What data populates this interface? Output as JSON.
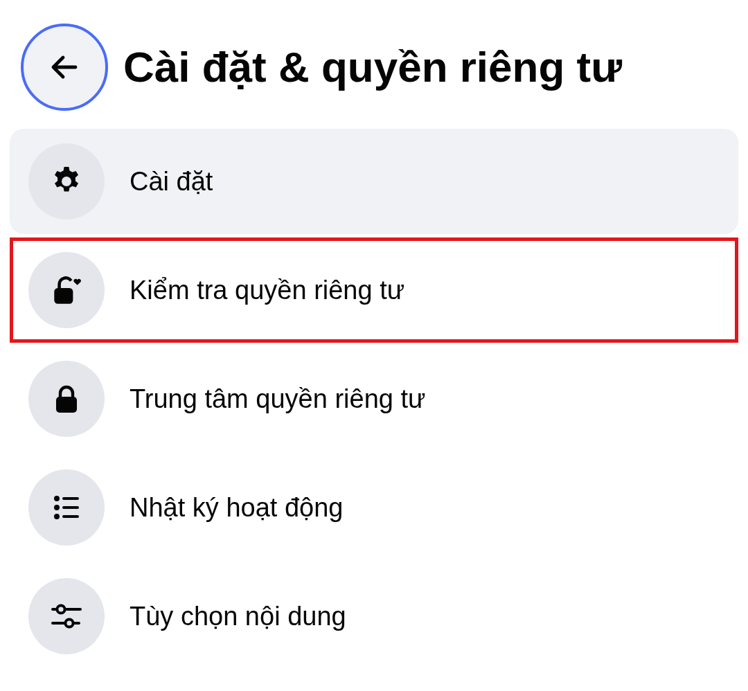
{
  "header": {
    "back_button": {
      "focused": true
    },
    "title": "Cài đặt & quyền riêng tư"
  },
  "items": [
    {
      "kind": "gear",
      "label": "Cài đặt",
      "hovered": true,
      "outlined": false
    },
    {
      "kind": "lock-heart",
      "label": "Kiểm tra quyền riêng tư",
      "hovered": false,
      "outlined": true
    },
    {
      "kind": "lock",
      "label": "Trung tâm quyền riêng tư",
      "hovered": false,
      "outlined": false
    },
    {
      "kind": "list",
      "label": "Nhật ký hoạt động",
      "hovered": false,
      "outlined": false
    },
    {
      "kind": "sliders",
      "label": "Tùy chọn nội dung",
      "hovered": false,
      "outlined": false
    }
  ]
}
